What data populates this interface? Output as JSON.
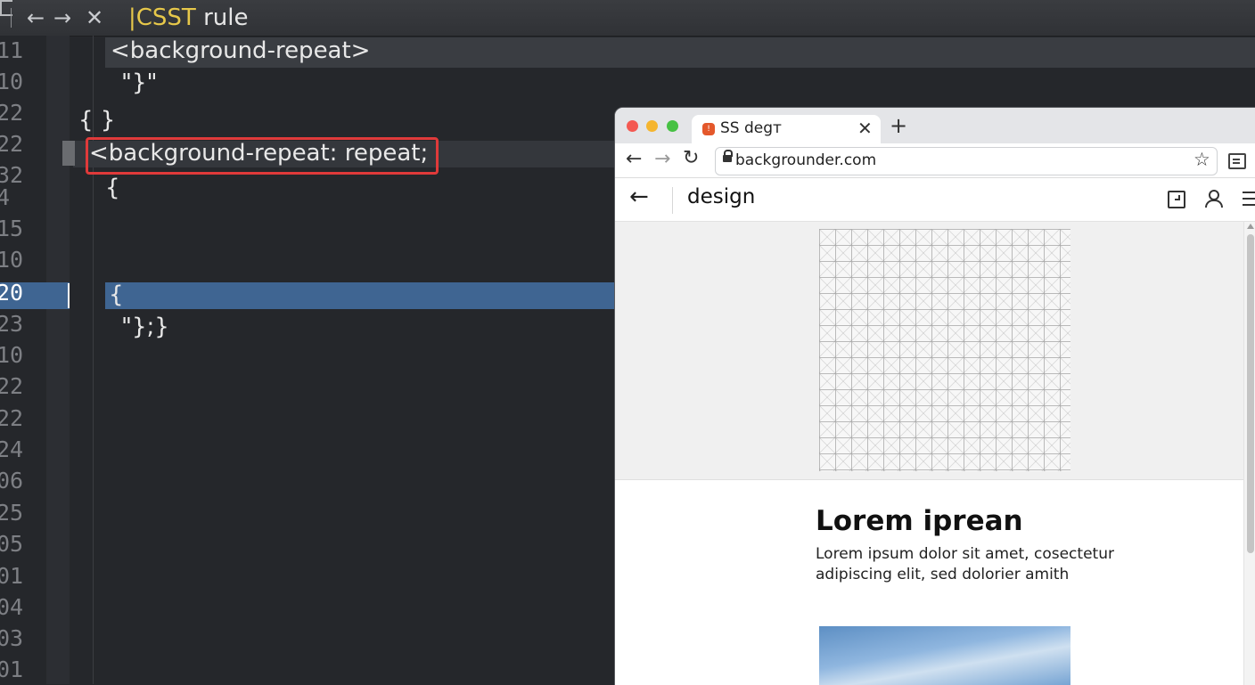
{
  "editor": {
    "title_prefix": "|",
    "title_accent": "CSST",
    "title_rest": " rule",
    "line_numbers": [
      "11",
      "10",
      "22",
      "22",
      "32",
      "4",
      "15",
      "10",
      "20",
      "23",
      "10",
      "22",
      "22",
      "24",
      "06",
      "25",
      "05",
      "01",
      "04",
      "03",
      "01"
    ],
    "code_lines": [
      "<background-repeat>",
      "\"}\"",
      "{ }",
      "<background-repeat: repeat;",
      "{",
      "{",
      "\"};}"
    ]
  },
  "browser": {
    "tab_title": "SS degт",
    "tab_favicon": "!",
    "url": "backgrounder.com",
    "site_title": "design",
    "article_title": "Lorem iprean",
    "article_body": "Lorem ipsum dolor sit amet, cosectetur adipiscing elit, sed dolorier amith"
  },
  "icons": {
    "back": "←",
    "forward": "→",
    "close": "✕",
    "reload": "↻",
    "star": "☆",
    "new_tab": "+",
    "tab_close": "✕"
  },
  "colors": {
    "editor_bg": "#25272b",
    "selection": "#3f6592",
    "highlight_box": "#e03a3a",
    "title_accent": "#e7c84a"
  }
}
